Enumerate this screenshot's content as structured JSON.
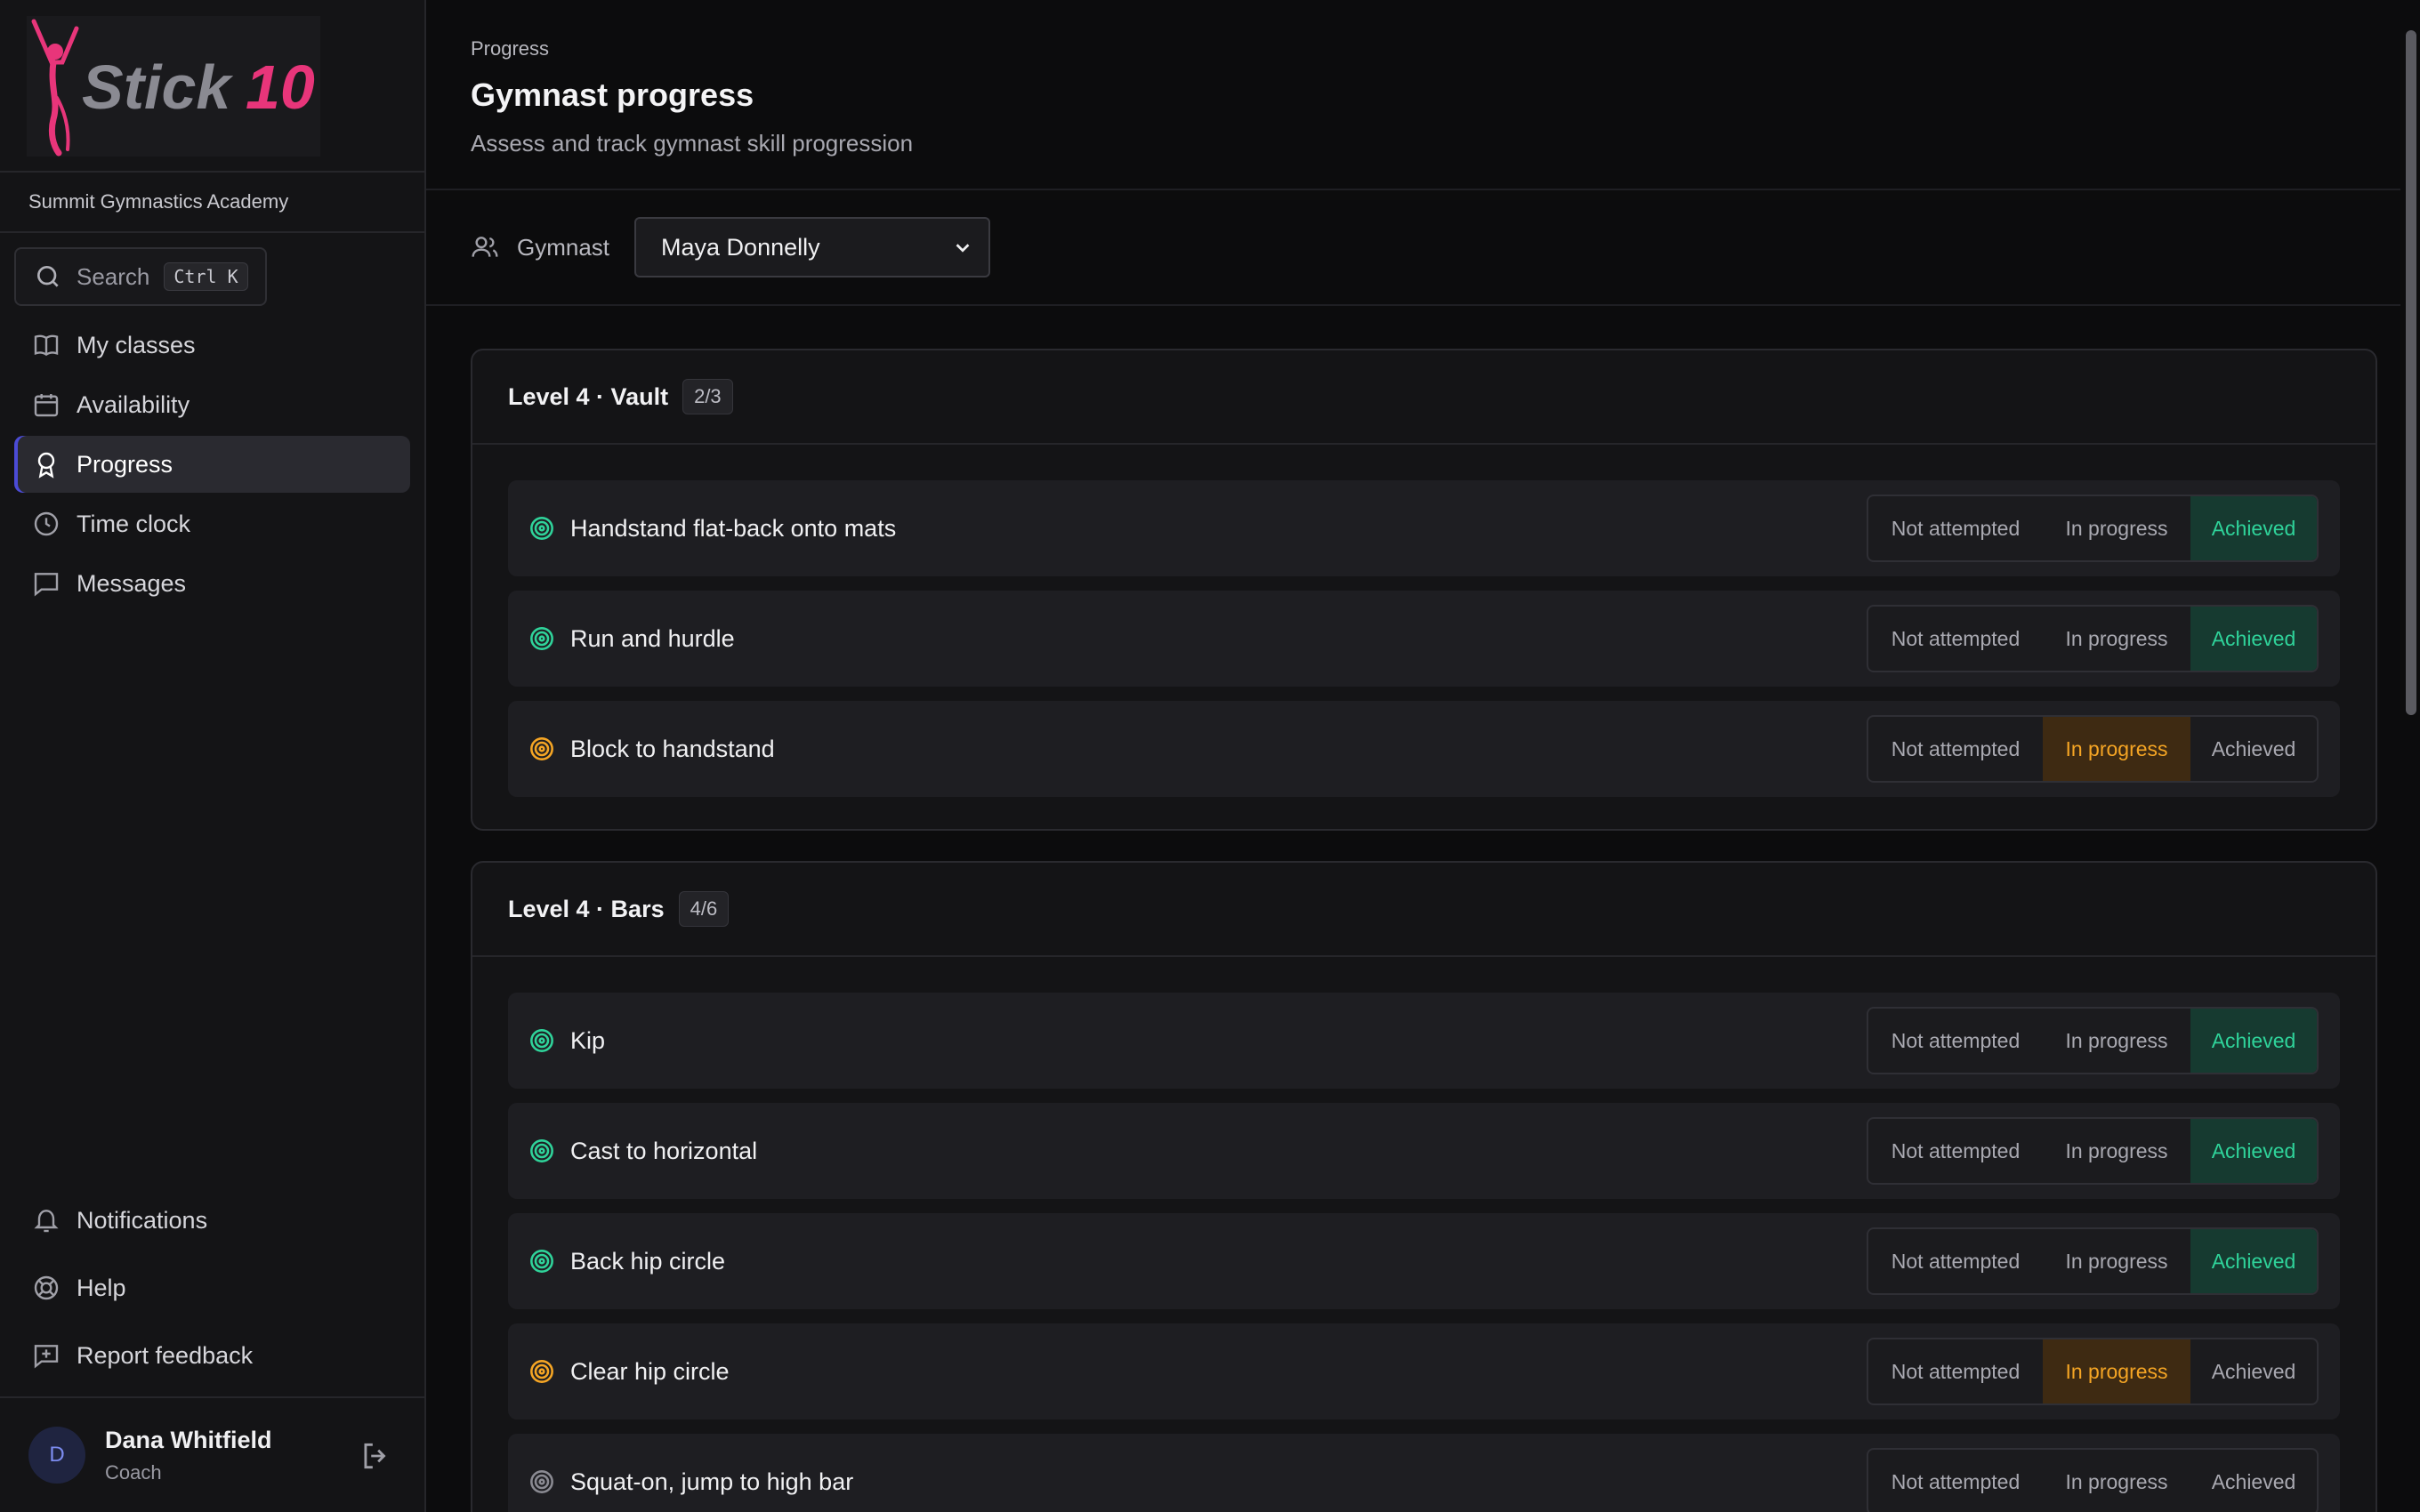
{
  "brand": {
    "logo_text": "Stick10",
    "accent": "#e8357a"
  },
  "org_name": "Summit Gymnastics Academy",
  "search": {
    "label": "Search",
    "shortcut": "Ctrl K"
  },
  "nav": [
    {
      "label": "My classes",
      "icon": "book-icon",
      "active": false
    },
    {
      "label": "Availability",
      "icon": "calendar-icon",
      "active": false
    },
    {
      "label": "Progress",
      "icon": "award-icon",
      "active": true
    },
    {
      "label": "Time clock",
      "icon": "clock-icon",
      "active": false
    },
    {
      "label": "Messages",
      "icon": "message-icon",
      "active": false
    }
  ],
  "bottom_nav": [
    {
      "label": "Notifications",
      "icon": "bell-icon"
    },
    {
      "label": "Help",
      "icon": "lifebuoy-icon"
    },
    {
      "label": "Report feedback",
      "icon": "feedback-icon"
    }
  ],
  "user": {
    "initial": "D",
    "name": "Dana Whitfield",
    "role": "Coach"
  },
  "header": {
    "breadcrumb": "Progress",
    "title": "Gymnast progress",
    "subtitle": "Assess and track gymnast skill progression"
  },
  "filter": {
    "label": "Gymnast",
    "selected": "Maya Donnelly"
  },
  "status_labels": {
    "not_attempted": "Not attempted",
    "in_progress": "In progress",
    "achieved": "Achieved"
  },
  "colors": {
    "achieved": "#2fd39a",
    "in_progress": "#f5a524",
    "not_attempted": "#8a8a92"
  },
  "groups": [
    {
      "title": "Level 4 · Vault",
      "count": "2/3",
      "skills": [
        {
          "name": "Handstand flat-back onto mats",
          "status": "achieved"
        },
        {
          "name": "Run and hurdle",
          "status": "achieved"
        },
        {
          "name": "Block to handstand",
          "status": "in_progress"
        }
      ]
    },
    {
      "title": "Level 4 · Bars",
      "count": "4/6",
      "skills": [
        {
          "name": "Kip",
          "status": "achieved"
        },
        {
          "name": "Cast to horizontal",
          "status": "achieved"
        },
        {
          "name": "Back hip circle",
          "status": "achieved"
        },
        {
          "name": "Clear hip circle",
          "status": "in_progress"
        },
        {
          "name": "Squat-on, jump to high bar",
          "status": "not_attempted"
        }
      ]
    }
  ]
}
